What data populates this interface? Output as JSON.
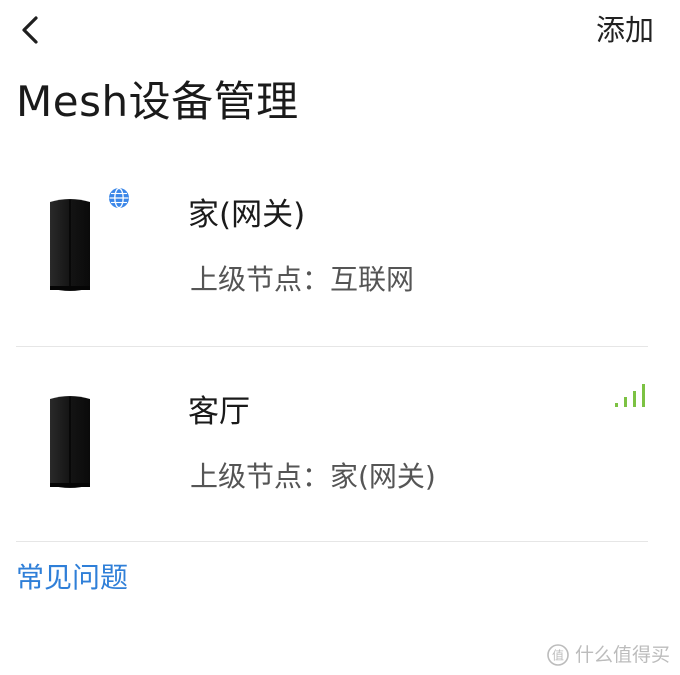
{
  "header": {
    "back_icon": "chevron-left-icon",
    "add_label": "添加"
  },
  "title": "Mesh设备管理",
  "devices": [
    {
      "name": "家(网关)",
      "parent_label": "上级节点：互联网",
      "status_icon": "globe-icon",
      "status_color": "#3a86e8"
    },
    {
      "name": "客厅",
      "parent_label": "上级节点：家(网关)",
      "status_icon": "signal-strength-icon",
      "status_color": "#7cc243"
    }
  ],
  "faq_label": "常见问题",
  "colors": {
    "accent": "#2f7fd8",
    "signal": "#7cc243",
    "divider": "#e6e6e6"
  },
  "watermark": {
    "text": "什么值得买",
    "icon": "zhi-logo-icon"
  }
}
